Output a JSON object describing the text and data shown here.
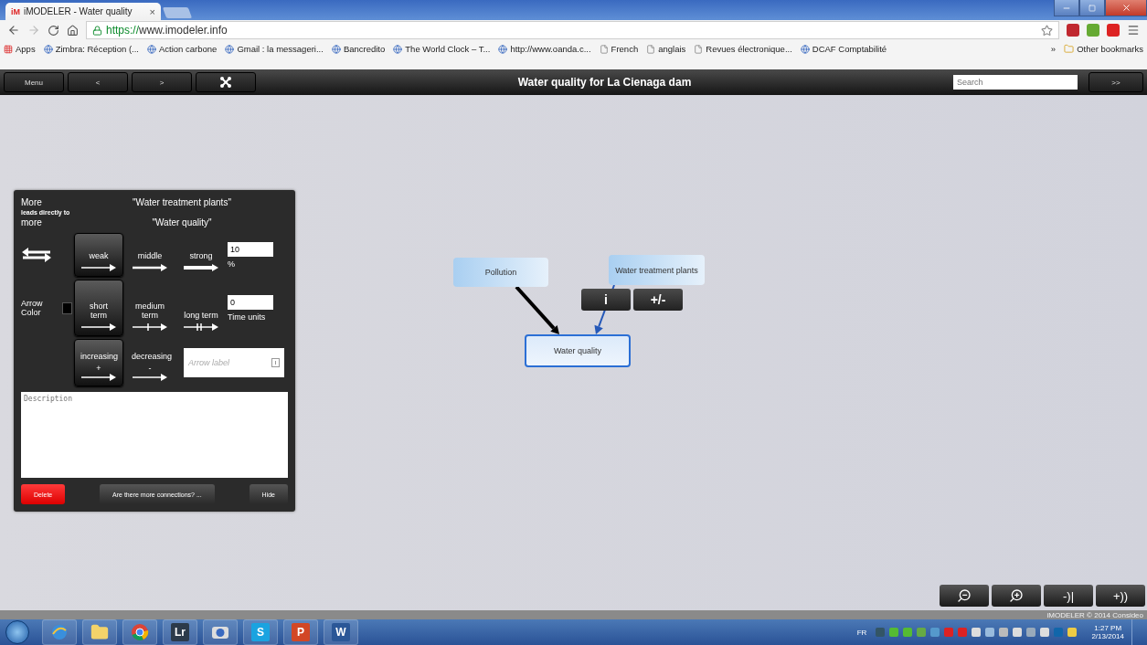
{
  "browser": {
    "tab": {
      "favicon": "iM",
      "title": "iMODELER - Water quality",
      "close": "×"
    },
    "url": {
      "scheme": "https://",
      "rest": "www.imodeler.info"
    },
    "bookmarks": [
      {
        "label": "Apps",
        "kind": "apps"
      },
      {
        "label": "Zimbra: Réception (...",
        "kind": "site"
      },
      {
        "label": "Action carbone",
        "kind": "site"
      },
      {
        "label": "Gmail : la messageri...",
        "kind": "site"
      },
      {
        "label": "Bancredito",
        "kind": "site"
      },
      {
        "label": "The World Clock – T...",
        "kind": "site"
      },
      {
        "label": "http://www.oanda.c...",
        "kind": "site"
      },
      {
        "label": "French",
        "kind": "page"
      },
      {
        "label": "anglais",
        "kind": "page"
      },
      {
        "label": "Revues électronique...",
        "kind": "page"
      },
      {
        "label": "DCAF Comptabilité",
        "kind": "site"
      }
    ],
    "more_bookmarks": "»",
    "other_bookmarks": "Other bookmarks"
  },
  "toolbar": {
    "buttons": [
      "Menu",
      "<",
      ">"
    ],
    "title": "Water quality for La Cienaga dam",
    "search_placeholder": "Search",
    "go": ">>"
  },
  "panel": {
    "source_label": "More",
    "relation": "leads directly to",
    "target_label": "more",
    "source_name": "\"Water treatment plants\"",
    "target_name": "\"Water quality\"",
    "strength": [
      {
        "label": "weak",
        "kind": "thin",
        "selected": true
      },
      {
        "label": "middle",
        "kind": "medium",
        "selected": false
      },
      {
        "label": "strong",
        "kind": "thick",
        "selected": false
      }
    ],
    "timing": [
      {
        "label": "short term",
        "kind": "thin",
        "selected": true
      },
      {
        "label": "medium term",
        "kind": "one-bar",
        "selected": false
      },
      {
        "label": "long term",
        "kind": "two-bar",
        "selected": false
      }
    ],
    "direction": [
      {
        "label": "increasing",
        "sign": "+",
        "selected": true
      },
      {
        "label": "decreasing",
        "sign": "-",
        "selected": false
      }
    ],
    "percent": {
      "value": "10",
      "unit": "%"
    },
    "delay": {
      "value": "0",
      "unit": "Time units"
    },
    "arrow_color": {
      "label": "Arrow Color",
      "color": "#000000"
    },
    "arrow_label_placeholder": "Arrow label",
    "description_placeholder": "Description",
    "buttons": [
      {
        "label": "Delete",
        "kind": "danger"
      },
      {
        "label": "Are there more connections? ...",
        "kind": "normal"
      },
      {
        "label": "Hide",
        "kind": "normal"
      }
    ]
  },
  "nodes": [
    {
      "name": "Pollution",
      "selected": false
    },
    {
      "name": "Water treatment plants",
      "selected": false
    },
    {
      "name": "Water quality",
      "selected": true
    }
  ],
  "edges": [
    {
      "selected": false
    },
    {
      "selected": true
    }
  ],
  "edge_menu": [
    "i",
    "+/-"
  ],
  "zoom_controls": [
    {
      "kind": "zoom-out"
    },
    {
      "kind": "zoom-in"
    },
    {
      "kind": "text",
      "label": "-)|"
    },
    {
      "kind": "text",
      "label": "+))"
    }
  ],
  "footer": "iMODELER © 2014 Consideo",
  "taskbar": {
    "apps": [
      {
        "kind": "browser"
      },
      {
        "kind": "folder"
      },
      {
        "kind": "chrome"
      },
      {
        "kind": "letter",
        "label": "Lr",
        "color": "#2c3a4a"
      },
      {
        "kind": "camera"
      },
      {
        "kind": "letter",
        "label": "S",
        "color": "#1aa3e0"
      },
      {
        "kind": "letter",
        "label": "P",
        "color": "#d24726"
      },
      {
        "kind": "letter",
        "label": "W",
        "color": "#2b5797"
      }
    ],
    "language": "FR",
    "time": "1:27 PM",
    "date": "2/13/2014"
  }
}
